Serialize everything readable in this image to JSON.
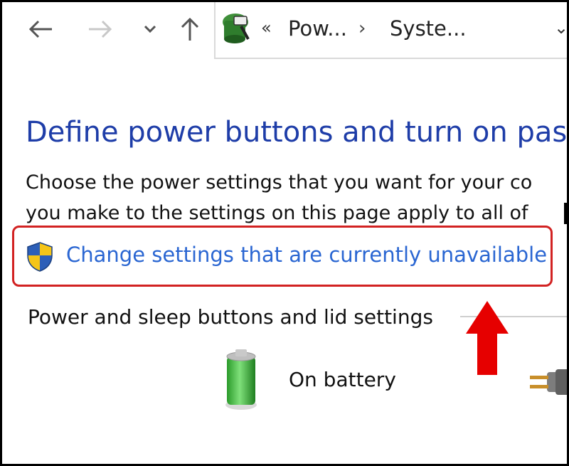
{
  "navigation": {
    "back_icon": "arrow-left-icon",
    "forward_icon": "arrow-right-icon",
    "recent_icon": "chevron-down-icon",
    "up_icon": "arrow-up-icon"
  },
  "addressbar": {
    "icon": "power-options-icon",
    "overflow": "«",
    "crumbs": [
      "Pow...",
      "Syste..."
    ],
    "separator": "›",
    "dropdown": "⌄"
  },
  "main": {
    "title": "Define power buttons and turn on passw",
    "description_lines": [
      "Choose the power settings that you want for your co",
      "you make to the settings on this page apply to all of"
    ],
    "change_link": "Change settings that are currently unavailable",
    "change_icon": "uac-shield-icon",
    "section_header": "Power and sleep buttons and lid settings",
    "on_battery_label": "On battery"
  },
  "colors": {
    "title": "#1e3da8",
    "link": "#2a66d2",
    "highlight": "#d22222",
    "annotation_arrow": "#e60000"
  }
}
